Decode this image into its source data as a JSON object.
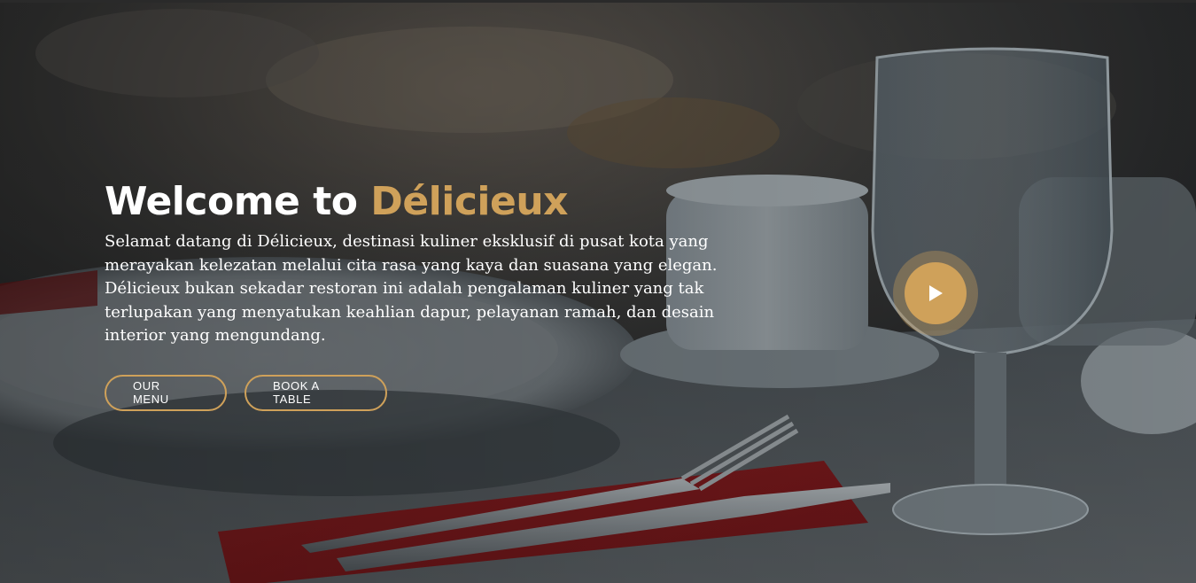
{
  "hero": {
    "title_prefix": "Welcome to ",
    "title_brand": "Délicieux",
    "description": "Selamat datang di Délicieux, destinasi kuliner eksklusif di pusat kota yang merayakan kelezatan melalui cita rasa yang kaya dan suasana yang elegan. Délicieux bukan sekadar restoran ini adalah pengalaman kuliner yang tak terlupakan yang menyatukan keahlian dapur, pelayanan ramah, dan desain interior yang mengundang.",
    "buttons": {
      "menu_label": "OUR MENU",
      "book_label": "BOOK A TABLE"
    },
    "play_icon": "play-icon"
  },
  "colors": {
    "accent": "#cfa15a",
    "text": "#ffffff",
    "napkin": "#8e1f22"
  }
}
